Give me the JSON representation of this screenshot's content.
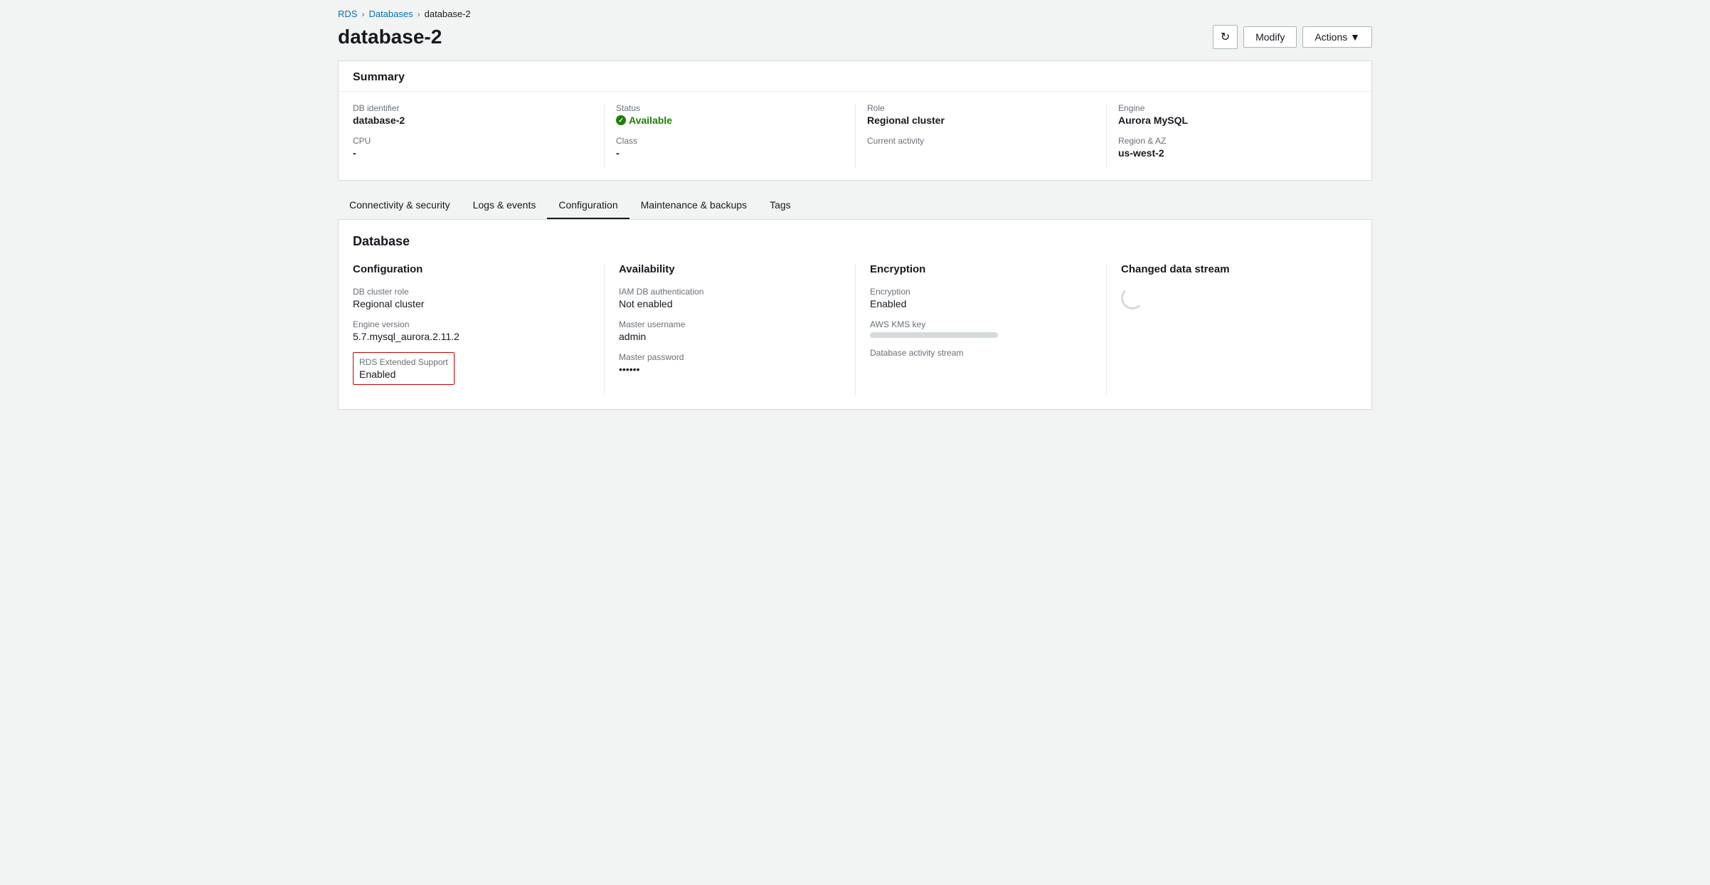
{
  "breadcrumb": {
    "rds": "RDS",
    "databases": "Databases",
    "current": "database-2"
  },
  "page": {
    "title": "database-2",
    "refresh_label": "↻",
    "modify_label": "Modify",
    "actions_label": "Actions ▼"
  },
  "summary": {
    "title": "Summary",
    "db_identifier_label": "DB identifier",
    "db_identifier_value": "database-2",
    "cpu_label": "CPU",
    "cpu_value": "-",
    "status_label": "Status",
    "status_value": "Available",
    "class_label": "Class",
    "class_value": "-",
    "role_label": "Role",
    "role_value": "Regional cluster",
    "current_activity_label": "Current activity",
    "current_activity_value": "",
    "engine_label": "Engine",
    "engine_value": "Aurora MySQL",
    "region_az_label": "Region & AZ",
    "region_az_value": "us-west-2"
  },
  "tabs": [
    {
      "id": "connectivity",
      "label": "Connectivity & security"
    },
    {
      "id": "logs",
      "label": "Logs & events"
    },
    {
      "id": "configuration",
      "label": "Configuration",
      "active": true
    },
    {
      "id": "maintenance",
      "label": "Maintenance & backups"
    },
    {
      "id": "tags",
      "label": "Tags"
    }
  ],
  "database_section": {
    "title": "Database",
    "configuration": {
      "title": "Configuration",
      "db_cluster_role_label": "DB cluster role",
      "db_cluster_role_value": "Regional cluster",
      "engine_version_label": "Engine version",
      "engine_version_value": "5.7.mysql_aurora.2.11.2",
      "rds_extended_support_label": "RDS Extended Support",
      "rds_extended_support_value": "Enabled"
    },
    "availability": {
      "title": "Availability",
      "iam_db_auth_label": "IAM DB authentication",
      "iam_db_auth_value": "Not enabled",
      "master_username_label": "Master username",
      "master_username_value": "admin",
      "master_password_label": "Master password",
      "master_password_value": "••••••"
    },
    "encryption": {
      "title": "Encryption",
      "encryption_label": "Encryption",
      "encryption_value": "Enabled",
      "aws_kms_key_label": "AWS KMS key",
      "aws_kms_key_value": "",
      "database_activity_stream_label": "Database activity stream"
    },
    "changed_data_stream": {
      "title": "Changed data stream"
    }
  }
}
